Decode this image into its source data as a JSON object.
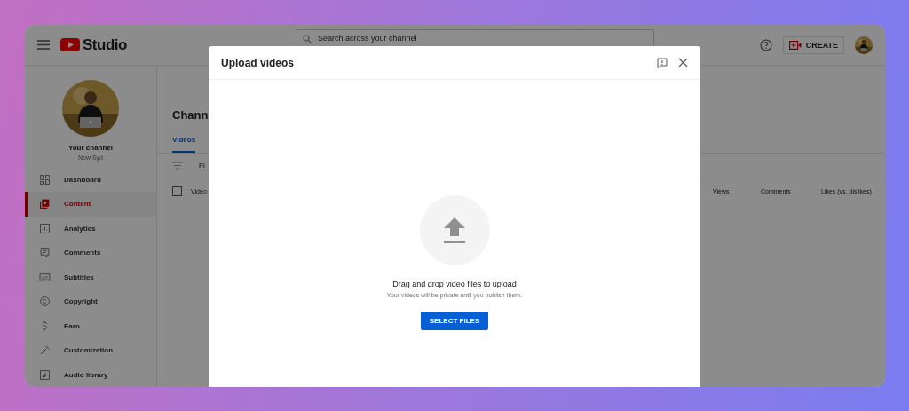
{
  "header": {
    "logo": "Studio",
    "search": {
      "placeholder": "Search across your channel"
    },
    "create_button": "CREATE"
  },
  "sidebar": {
    "channel_title": "Your channel",
    "channel_name": "Now Syd",
    "items": [
      {
        "label": "Dashboard",
        "selected": false
      },
      {
        "label": "Content",
        "selected": true
      },
      {
        "label": "Analytics",
        "selected": false
      },
      {
        "label": "Comments",
        "selected": false
      },
      {
        "label": "Subtitles",
        "selected": false
      },
      {
        "label": "Copyright",
        "selected": false
      },
      {
        "label": "Earn",
        "selected": false
      },
      {
        "label": "Customization",
        "selected": false
      },
      {
        "label": "Audio library",
        "selected": false
      }
    ]
  },
  "main": {
    "title": "Chann",
    "tabs": [
      {
        "label": "Videos",
        "selected": true
      }
    ],
    "filter": "Fi",
    "select_all": {
      "checked": false
    },
    "columns": [
      "Video",
      "Views",
      "Comments",
      "Likes (vs. dislikes)"
    ]
  },
  "dialog": {
    "title": "Upload videos",
    "heading": "Drag and drop video files to upload",
    "subtext": "Your videos will be private until you publish them.",
    "button": "SELECT FILES"
  }
}
